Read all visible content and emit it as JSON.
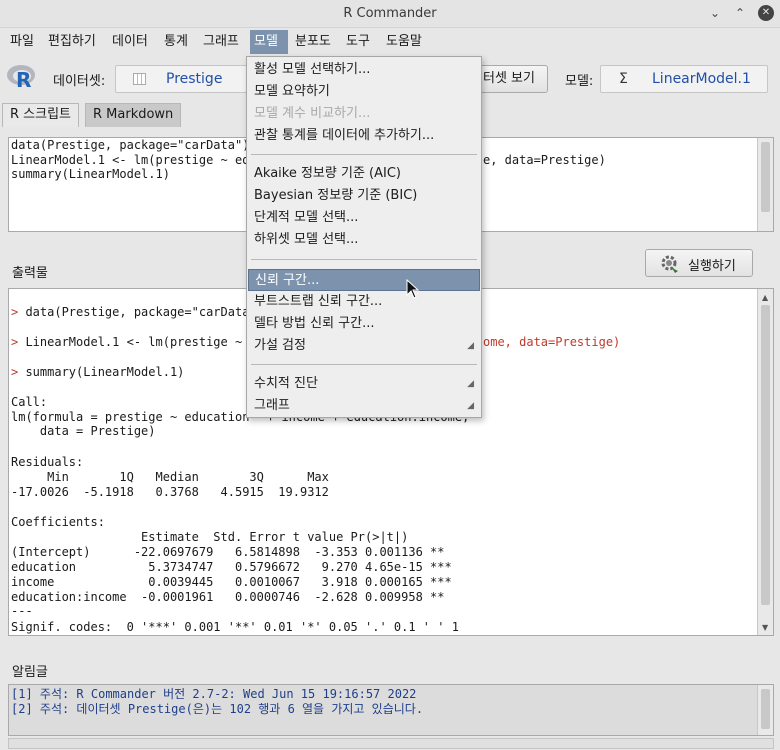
{
  "window": {
    "title": "R Commander"
  },
  "menubar": [
    "파일",
    "편집하기",
    "데이터",
    "통계",
    "그래프",
    "모델",
    "분포도",
    "도구",
    "도움말"
  ],
  "toolbar": {
    "dataset_label": "데이터셋:",
    "dataset_value": "Prestige",
    "view_button": "터셋 보기",
    "model_label": "모델:",
    "model_value": "LinearModel.1"
  },
  "tabs": [
    "R 스크립트",
    "R Markdown"
  ],
  "script_lines": [
    "data(Prestige, package=\"carData\")",
    "LinearModel.1 <- lm(prestige ~ edu",
    "summary(LinearModel.1)"
  ],
  "script_line2_tail": "e, data=Prestige)",
  "output_label": "출력물",
  "run_button": "실행하기",
  "output": {
    "cmd1": "data(Prestige, package=\"carData\"",
    "cmd2a": "LinearModel.1 <- lm(prestige ~ e",
    "cmd2b": "ome, data=Prestige)",
    "cmd3": "summary(LinearModel.1)",
    "call_label": "Call:",
    "call_line1a": "lm(formula = prestige ~ education",
    "call_line1b": "+ income + education:income,",
    "call_line2": "    data = Prestige)",
    "residuals_label": "Residuals:",
    "residuals_header": "     Min       1Q   Median       3Q      Max",
    "residuals_values": "-17.0026  -5.1918   0.3768   4.5915  19.9312",
    "coef_label": "Coefficients:",
    "coef_header": "                  Estimate  Std. Error t value Pr(>|t|)",
    "coef_rows": [
      "(Intercept)      -22.0697679   6.5814898  -3.353 0.001136 **",
      "education          5.3734747   0.5796672   9.270 4.65e-15 ***",
      "income             0.0039445   0.0010067   3.918 0.000165 ***",
      "education:income  -0.0001961   0.0000746  -2.628 0.009958 **"
    ],
    "dashes": "---",
    "signif": "Signif. codes:  0 '***' 0.001 '**' 0.01 '*' 0.05 '.' 0.1 ' ' 1"
  },
  "messages_label": "알림글",
  "messages": [
    "[1] 주석: R Commander 버전 2.7-2: Wed Jun 15 19:16:57 2022",
    "[2] 주석: 데이터셋 Prestige(은)는 102 행과 6 열을 가지고 있습니다."
  ],
  "model_menu": {
    "group1": [
      "활성 모델 선택하기...",
      "모델 요약하기",
      "모델 계수 비교하기...",
      "관찰 통계를 데이터에 추가하기..."
    ],
    "group2": [
      "Akaike 정보량 기준 (AIC)",
      "Bayesian 정보량 기준 (BIC)",
      "단계적 모델 선택...",
      "하위셋 모델 선택..."
    ],
    "group3": [
      "신뢰 구간...",
      "부트스트랩 신뢰 구간...",
      "델타 방법 신뢰 구간...",
      "가설 검정"
    ],
    "group4": [
      "수치적 진단",
      "그래프"
    ]
  },
  "colors": {
    "highlight": "#7d93ad",
    "prompt": "#c0392b",
    "message_text": "#1f3f8a"
  }
}
